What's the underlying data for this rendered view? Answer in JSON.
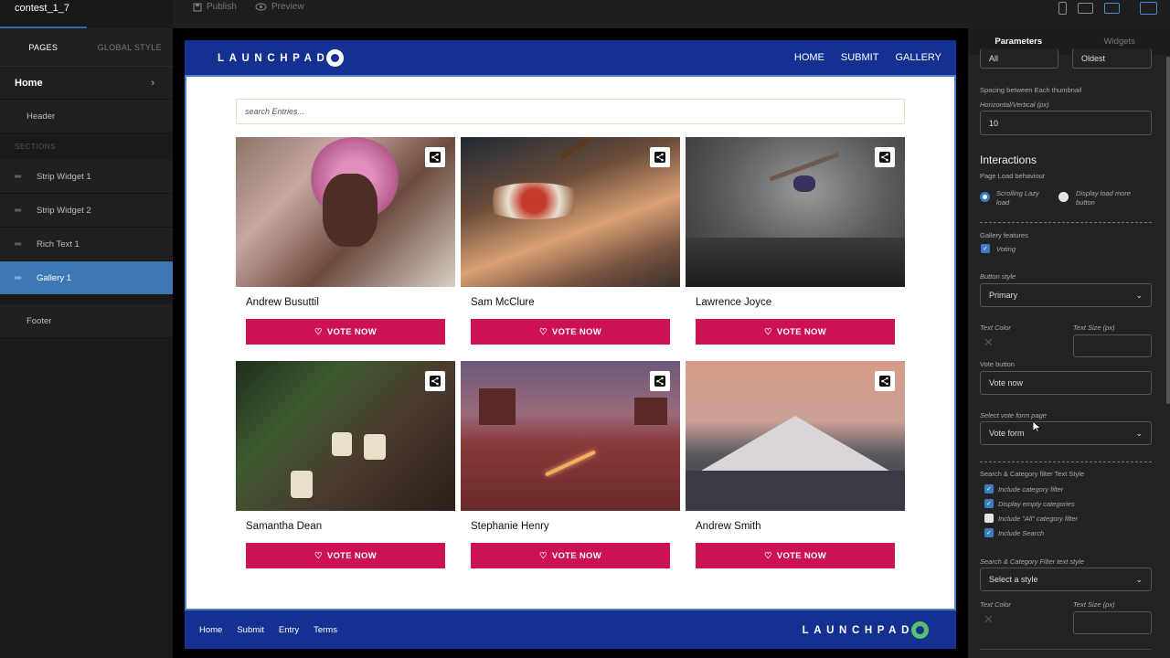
{
  "project": {
    "title": "contest_1_7"
  },
  "toolbar": {
    "publish_label": "Publish",
    "preview_label": "Preview"
  },
  "left": {
    "tabs": [
      "PAGES",
      "GLOBAL STYLE"
    ],
    "home_label": "Home",
    "header_label": "Header",
    "sections_label": "SECTIONS",
    "sections": [
      "Strip Widget 1",
      "Strip Widget 2",
      "Rich Text 1",
      "Gallery 1"
    ],
    "footer_label": "Footer"
  },
  "site": {
    "logo_text": "LAUNCHPAD",
    "nav": [
      "HOME",
      "SUBMIT",
      "GALLERY"
    ],
    "search_placeholder": "search Entries...",
    "vote_label": "VOTE NOW",
    "entries": [
      {
        "name": "Andrew Busuttil"
      },
      {
        "name": "Sam McClure"
      },
      {
        "name": "Lawrence Joyce"
      },
      {
        "name": "Samantha Dean"
      },
      {
        "name": "Stephanie Henry"
      },
      {
        "name": "Andrew Smith"
      }
    ],
    "footer_links": [
      "Home",
      "Submit",
      "Entry",
      "Terms"
    ],
    "colors": {
      "brand": "#143191",
      "vote": "#cc1155"
    }
  },
  "right": {
    "tabs": [
      "Parameters",
      "Widgets"
    ],
    "top_select_1": "All",
    "top_select_2": "Oldest",
    "spacing_label": "Spacing between Each thumbnail",
    "spacing_sub": "Horizontal/Vertical (px)",
    "spacing_value": "10",
    "interactions_title": "Interactions",
    "page_load_label": "Page Load behaviour",
    "radio_1": "Scrolling Lazy load",
    "radio_2": "Display load more button",
    "gallery_features_label": "Gallery features",
    "voting_label": "Voting",
    "button_style_label": "Button style",
    "button_style_value": "Primary",
    "text_color_label": "Text Color",
    "text_size_label": "Text Size (px)",
    "vote_button_label": "Vote button",
    "vote_button_value": "Vote now",
    "vote_form_label": "Select vote form page",
    "vote_form_value": "Vote form",
    "filter_style_label": "Search & Category filter Text Style",
    "checks": [
      {
        "label": "Include category filter",
        "on": true
      },
      {
        "label": "Display empty categories",
        "on": true
      },
      {
        "label": "Include \"All\" category filter",
        "on": false
      },
      {
        "label": "Include Search",
        "on": true
      }
    ],
    "filter_text_style_label": "Search & Category Filter text style",
    "select_style_value": "Select a style",
    "text_color_label_2": "Text Color",
    "text_size_label_2": "Text Size (px)"
  }
}
